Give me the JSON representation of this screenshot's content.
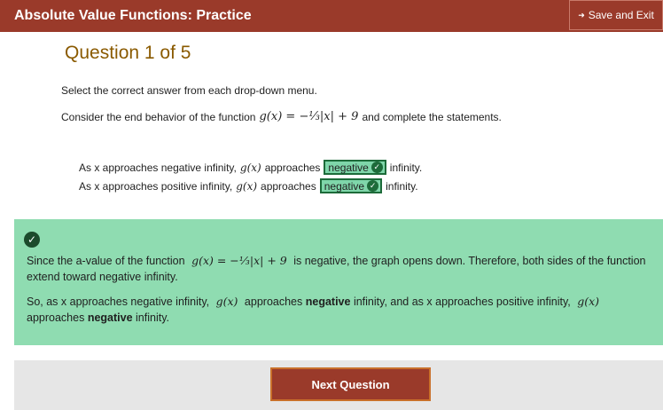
{
  "header": {
    "title": "Absolute Value Functions: Practice",
    "save_exit_icon": "exit-arrow-icon",
    "save_exit_label": "Save and Exit",
    "color": "#9a3a2a"
  },
  "question": {
    "title": "Question 1 of 5",
    "instructions": "Select the correct answer from each drop-down menu.",
    "prompt_before": "Consider the end behavior of the function",
    "function": "g(x) = −⅓|x| + 9",
    "prompt_after": "and complete the statements.",
    "statements": [
      {
        "prefix": "As x approaches negative infinity,",
        "fn": "g(x)",
        "verb": "approaches",
        "selected": "negative",
        "suffix": "infinity."
      },
      {
        "prefix": "As x approaches positive infinity,",
        "fn": "g(x)",
        "verb": "approaches",
        "selected": "negative",
        "suffix": "infinity."
      }
    ]
  },
  "feedback": {
    "status_icon": "check-circle-icon",
    "p1_before": "Since the a-value of the function",
    "p1_fn": "g(x) = −⅓|x| + 9",
    "p1_after": "is negative, the graph opens down. Therefore, both sides of the function extend toward negative infinity.",
    "p2_a": "So, as x approaches negative infinity,",
    "p2_fn1": "g(x)",
    "p2_b": "approaches",
    "p2_bold1": "negative",
    "p2_c": "infinity, and as x approaches positive infinity,",
    "p2_fn2": "g(x)",
    "p2_d": "approaches",
    "p2_bold2": "negative",
    "p2_e": "infinity.",
    "background": "#8fdcb1"
  },
  "footer": {
    "next_label": "Next Question"
  }
}
